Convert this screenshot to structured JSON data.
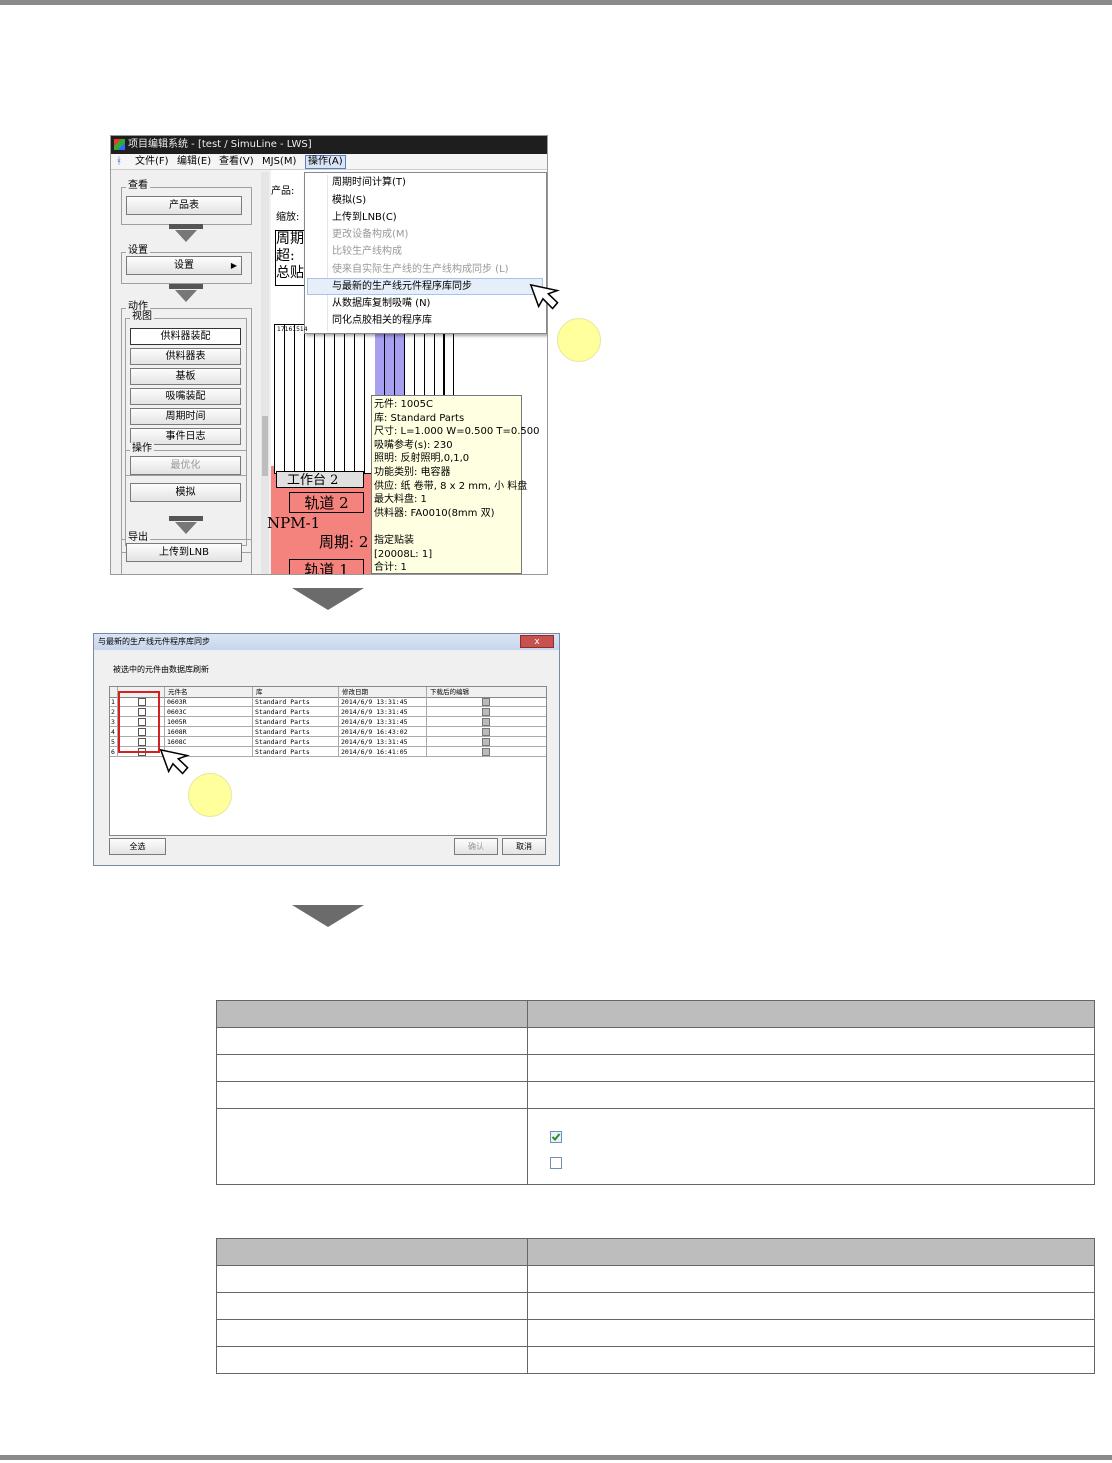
{
  "screenshot1": {
    "window_title": "项目编辑系统 - [test / SimuLine - LWS]",
    "menubar": [
      "文件(F)",
      "编辑(E)",
      "查看(V)",
      "MJS(M)",
      "操作(A)"
    ],
    "groups": {
      "view": "查看",
      "setup": "设置",
      "action": "动作",
      "subview": "视图",
      "operate": "操作",
      "export": "导出"
    },
    "buttons": {
      "product_table": "产品表",
      "setup": "设置",
      "feeder_assign": "供料器装配",
      "feeder_table": "供料器表",
      "board": "基板",
      "nozzle_assign": "吸嘴装配",
      "cycle_time": "周期时间",
      "event_log": "事件日志",
      "optimize": "最优化",
      "simulate": "模拟",
      "upload_lnb": "上传到LNB"
    },
    "main_labels": {
      "product": "产品:",
      "zoom": "缩放:",
      "z1": "周期",
      "z2": "超:",
      "z3": "总贴",
      "feeder_nums": "17161514"
    },
    "menu_items": [
      {
        "label": "周期时间计算(T)",
        "disabled": false
      },
      {
        "label": "模拟(S)",
        "disabled": false
      },
      {
        "label": "上传到LNB(C)",
        "disabled": false
      },
      {
        "label": "更改设备构成(M)",
        "disabled": true
      },
      {
        "label": "比较生产线构成",
        "disabled": true
      },
      {
        "label": "使来自实际生产线的生产线构成同步 (L)",
        "disabled": true
      },
      {
        "label": "与最新的生产线元件程序库同步",
        "disabled": false,
        "highlighted": true
      },
      {
        "label": "从数据库复制吸嘴 (N)",
        "disabled": false
      },
      {
        "label": "同化点胶相关的程序库",
        "disabled": false
      }
    ],
    "canvas": {
      "table2": "工作台 2",
      "lane2": "轨道 2",
      "machine": "NPM-1",
      "cycle": "周期: 2",
      "lane1": "轨道 1"
    },
    "tooltip": [
      "元件: 1005C",
      "库: Standard Parts",
      "尺寸: L=1.000 W=0.500 T=0.500",
      "吸嘴参考(s): 230",
      "照明: 反射照明,0,1,0",
      "功能类别: 电容器",
      "供应: 纸 卷带, 8 x 2 mm, 小 料盘",
      "最大料盘: 1",
      "供料器: FA0010(8mm 双)",
      "",
      "指定贴装",
      "[20008L: 1]",
      "合计: 1"
    ]
  },
  "screenshot2": {
    "title": "与最新的生产线元件程序库同步",
    "close": "x",
    "instruction": "被选中的元件由数据库刷新",
    "columns": [
      "",
      "元件名",
      "库",
      "修改日期",
      "下载后的编辑"
    ],
    "rows": [
      {
        "n": "1",
        "part": "0603R",
        "lib": "Standard Parts",
        "date": "2014/6/9 13:31:45"
      },
      {
        "n": "2",
        "part": "0603C",
        "lib": "Standard Parts",
        "date": "2014/6/9 13:31:45"
      },
      {
        "n": "3",
        "part": "1005R",
        "lib": "Standard Parts",
        "date": "2014/6/9 13:31:45"
      },
      {
        "n": "4",
        "part": "1608R",
        "lib": "Standard Parts",
        "date": "2014/6/9 16:43:02"
      },
      {
        "n": "5",
        "part": "1608C",
        "lib": "Standard Parts",
        "date": "2014/6/9 13:31:45"
      },
      {
        "n": "6",
        "part": "",
        "lib": "Standard Parts",
        "date": "2014/6/9 16:41:05"
      }
    ],
    "select_all": "全选",
    "confirm": "确认",
    "cancel": "取消"
  },
  "colors": {
    "rule_bar": "#8a8a8a",
    "menu_highlight": "#e5eef9",
    "red_zone": "#f4827d",
    "callout": "#ffff9c",
    "table_header": "#bdbdbd",
    "purple_feeder": "#a7a0f0"
  }
}
